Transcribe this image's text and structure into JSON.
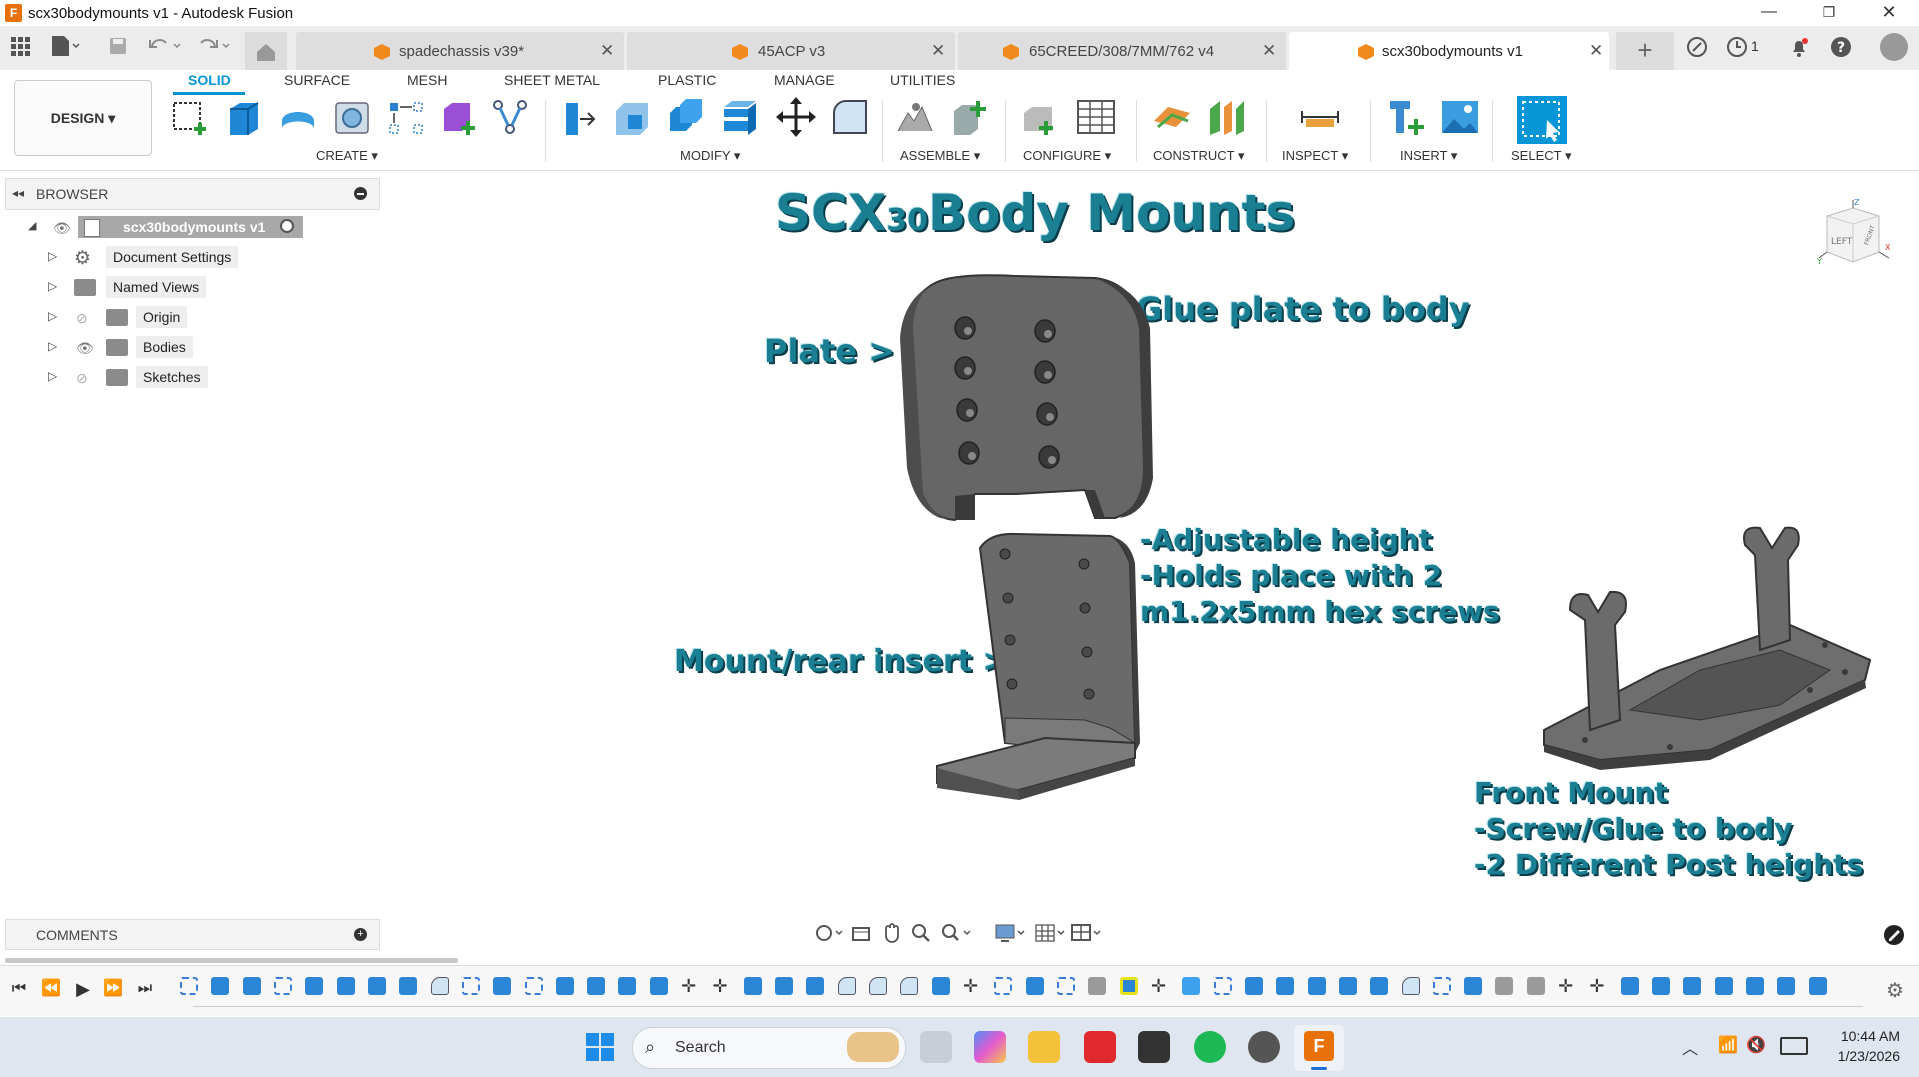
{
  "window": {
    "title": "scx30bodymounts v1 - Autodesk Fusion",
    "app_icon": "F"
  },
  "tabs": [
    {
      "label": "spadechassis v39*",
      "active": false
    },
    {
      "label": "45ACP v3",
      "active": false
    },
    {
      "label": "65CREED/308/7MM/762 v4",
      "active": false
    },
    {
      "label": "scx30bodymounts v1",
      "active": true
    }
  ],
  "tabbar": {
    "notification_count": "1"
  },
  "ribbon": {
    "workspace": "DESIGN ▾",
    "tabs": [
      "SOLID",
      "SURFACE",
      "MESH",
      "SHEET METAL",
      "PLASTIC",
      "MANAGE",
      "UTILITIES"
    ],
    "active_tab": "SOLID",
    "groups": {
      "create": "CREATE ▾",
      "modify": "MODIFY ▾",
      "assemble": "ASSEMBLE ▾",
      "configure": "CONFIGURE ▾",
      "construct": "CONSTRUCT ▾",
      "inspect": "INSPECT ▾",
      "insert": "INSERT ▾",
      "select": "SELECT ▾"
    }
  },
  "browser": {
    "title": "BROWSER",
    "root": "scx30bodymounts v1",
    "items": [
      {
        "label": "Document Settings"
      },
      {
        "label": "Named Views"
      },
      {
        "label": "Origin"
      },
      {
        "label": "Bodies"
      },
      {
        "label": "Sketches"
      }
    ]
  },
  "comments": {
    "title": "COMMENTS"
  },
  "canvas": {
    "heading_part1": "SCX",
    "heading_small": "30",
    "heading_part2": "Body Mounts",
    "plate_label": "Plate >",
    "glue_label": "Glue plate to body",
    "adjust_line1": "-Adjustable height",
    "adjust_line2": "-Holds place with 2",
    "adjust_line3": "m1.2x5mm  hex screws",
    "mount_label": "Mount/rear insert >",
    "front_line1": "Front Mount",
    "front_line2": "-Screw/Glue to body",
    "front_line3": "-2 Different Post heights",
    "viewcube_left": "LEFT",
    "viewcube_front": "FRONT"
  },
  "taskbar": {
    "search_label": "Search",
    "time": "10:44 AM",
    "date": "1/23/2026"
  },
  "colors": {
    "accent": "#0696d7",
    "canvas_text": "#1a7f93",
    "part_gray": "#6b6b68"
  }
}
